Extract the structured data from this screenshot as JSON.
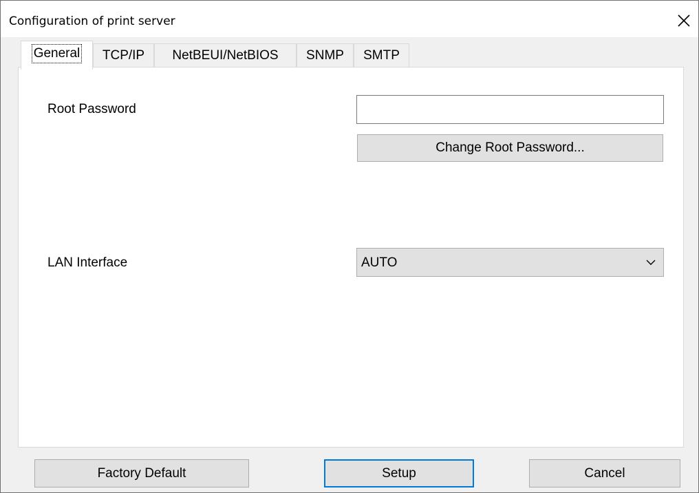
{
  "window": {
    "title": "Configuration of print server"
  },
  "tabs": [
    {
      "label": "General",
      "selected": true
    },
    {
      "label": "TCP/IP",
      "selected": false
    },
    {
      "label": "NetBEUI/NetBIOS",
      "selected": false
    },
    {
      "label": "SNMP",
      "selected": false
    },
    {
      "label": "SMTP",
      "selected": false
    }
  ],
  "general": {
    "root_password_label": "Root Password",
    "root_password_value": "",
    "change_password_button": "Change Root Password...",
    "lan_interface_label": "LAN Interface",
    "lan_interface_value": "AUTO"
  },
  "footer": {
    "factory_default_button": "Factory Default",
    "setup_button": "Setup",
    "cancel_button": "Cancel"
  },
  "icons": {
    "close": "close-icon",
    "dropdown": "chevron-down-icon"
  },
  "colors": {
    "default_button_border": "#0078d7",
    "button_face": "#e1e1e1",
    "dialog_background": "#f0f0f0"
  }
}
